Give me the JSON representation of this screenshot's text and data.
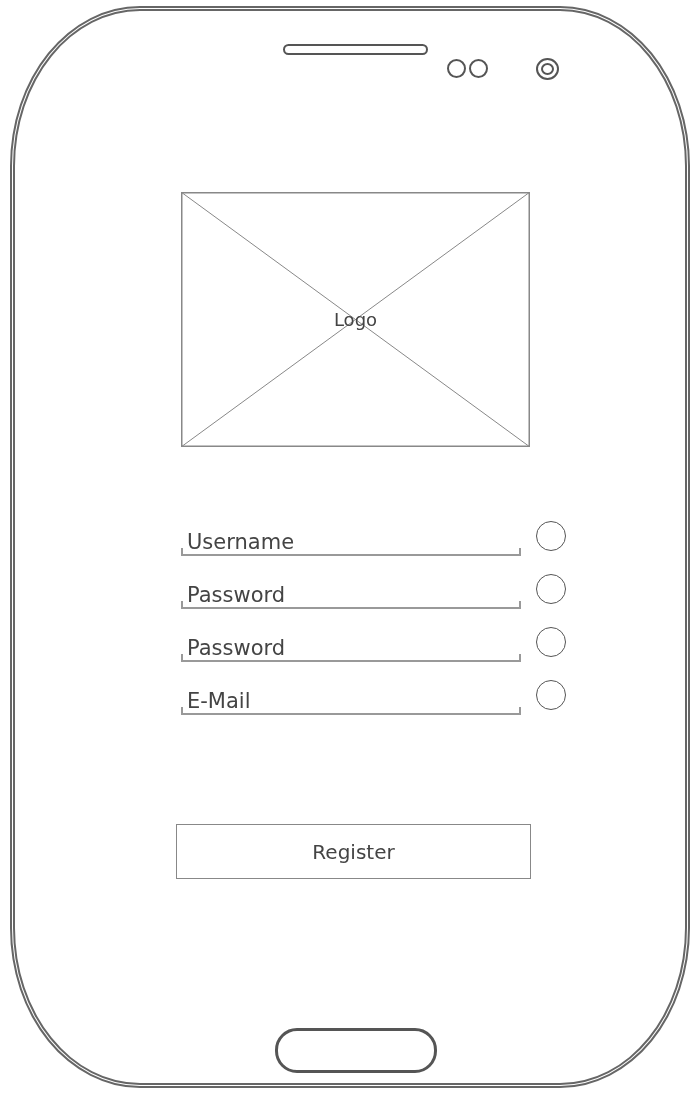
{
  "logo": {
    "label": "Logo"
  },
  "fields": [
    {
      "placeholder": "Username"
    },
    {
      "placeholder": "Password"
    },
    {
      "placeholder": "Password"
    },
    {
      "placeholder": "E-Mail"
    }
  ],
  "register_button": {
    "label": "Register"
  }
}
